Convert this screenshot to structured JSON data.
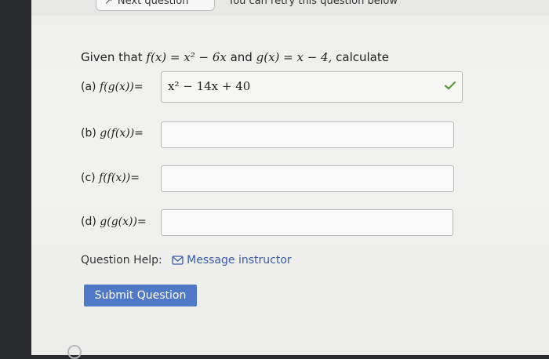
{
  "toolbar": {
    "next_label": "Next question",
    "retry_label": "You can retry this question below"
  },
  "question": {
    "given_text": "Given that",
    "f_def": "f(x) = x² − 6x",
    "and_text": "and",
    "g_def": "g(x) = x − 4,",
    "calc_text": "calculate"
  },
  "parts": [
    {
      "label": "(a)",
      "expr": "f(g(x))",
      "eq": "=",
      "value": "x² − 14x + 40",
      "status": "correct"
    },
    {
      "label": "(b)",
      "expr": "g(f(x))",
      "eq": "=",
      "value": ""
    },
    {
      "label": "(c)",
      "expr": "f(f(x))",
      "eq": "=",
      "value": ""
    },
    {
      "label": "(d)",
      "expr": "g(g(x))",
      "eq": "=",
      "value": ""
    }
  ],
  "help": {
    "label": "Question Help:",
    "link_text": "Message instructor",
    "icon": "mail-icon"
  },
  "submit_label": "Submit Question",
  "colors": {
    "accent": "#4f79c6",
    "link": "#3a5aa8",
    "check": "#5a9a3a"
  }
}
